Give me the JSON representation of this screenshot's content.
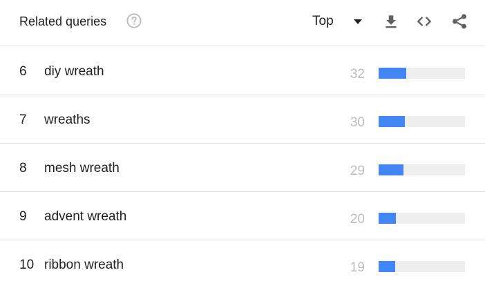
{
  "header": {
    "title": "Related queries",
    "help_icon": "help-circle-icon",
    "sort_label": "Top",
    "icons": [
      "chevron-down-icon",
      "download-icon",
      "code-icon",
      "share-icon"
    ]
  },
  "colors": {
    "bar": "#4285f4",
    "track": "#eeeeee",
    "value_text": "#bdbdbd"
  },
  "queries": [
    {
      "rank": "6",
      "query": "diy wreath",
      "value": "32",
      "level": 0.32
    },
    {
      "rank": "7",
      "query": "wreaths",
      "value": "30",
      "level": 0.3
    },
    {
      "rank": "8",
      "query": "mesh wreath",
      "value": "29",
      "level": 0.29
    },
    {
      "rank": "9",
      "query": "advent wreath",
      "value": "20",
      "level": 0.2
    },
    {
      "rank": "10",
      "query": "ribbon wreath",
      "value": "19",
      "level": 0.19
    }
  ]
}
